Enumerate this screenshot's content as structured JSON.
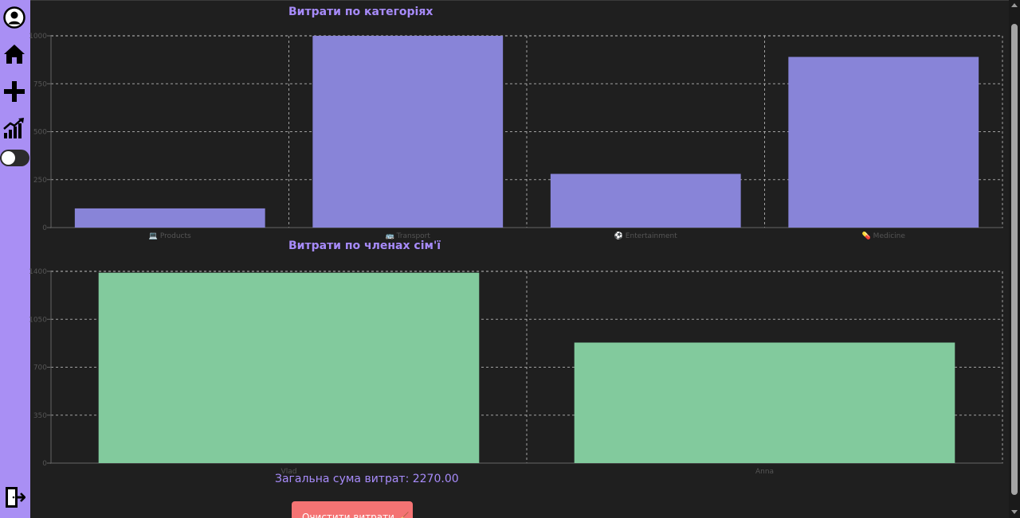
{
  "sidebar": {
    "icons": [
      "user-circle-icon",
      "home-icon",
      "plus-icon",
      "chart-growth-icon",
      "toggle-switch",
      "logout-door-icon"
    ]
  },
  "charts": {
    "categories_title": "Витрати по категоріях",
    "members_title": "Витрати по членах сім'ї"
  },
  "summary": {
    "total_text": "Загальна сума витрат: 2270.00"
  },
  "actions": {
    "clear_label": "Очистити витрати 🧹"
  },
  "colors": {
    "sidebar": "#a98ff4",
    "background": "#1f1f1f",
    "title": "#a78bfa",
    "category_bars": "#8884d8",
    "member_bars": "#82ca9d",
    "clear_button": "#f47373",
    "grid": "#cccccc"
  },
  "chart_data": [
    {
      "type": "bar",
      "title": "Витрати по категоріях",
      "categories": [
        "💻 Products",
        "🚌 Transport",
        "⚽ Entertainment",
        "💊 Medicine"
      ],
      "values": [
        100,
        1000,
        280,
        890
      ],
      "ylim": [
        0,
        1000
      ],
      "yticks": [
        "0",
        "250",
        "500",
        "750",
        "1000"
      ],
      "grid": true,
      "color": "#8884d8"
    },
    {
      "type": "bar",
      "title": "Витрати по членах сім'ї",
      "categories": [
        "Vlad",
        "Anna"
      ],
      "values": [
        1390,
        880
      ],
      "ylim": [
        0,
        1400
      ],
      "yticks": [
        "0",
        "350",
        "700",
        "1050",
        "1400"
      ],
      "grid": true,
      "color": "#82ca9d"
    }
  ]
}
